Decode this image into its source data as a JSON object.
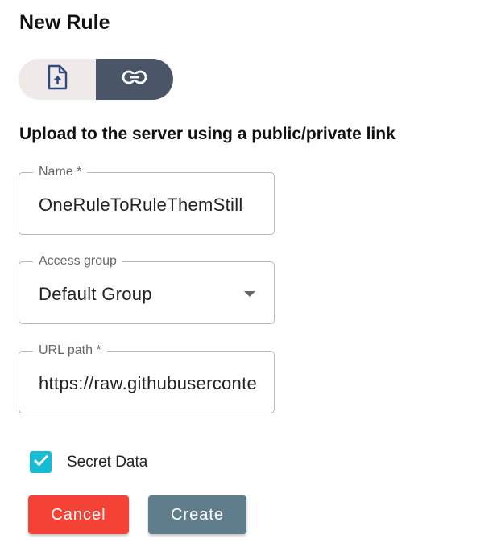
{
  "dialog": {
    "title": "New Rule",
    "subtitle": "Upload to the server using a public/private link"
  },
  "source_toggle": {
    "options": [
      {
        "icon": "file-upload-icon",
        "selected": false
      },
      {
        "icon": "link-icon",
        "selected": true
      }
    ]
  },
  "fields": {
    "name": {
      "label": "Name *",
      "value": "OneRuleToRuleThemStill"
    },
    "access_group": {
      "label": "Access group",
      "value": "Default Group"
    },
    "url_path": {
      "label": "URL path *",
      "value": "https://raw.githubusercontent.com"
    }
  },
  "secret_data": {
    "label": "Secret Data",
    "checked": true
  },
  "actions": {
    "cancel_label": "Cancel",
    "create_label": "Create"
  },
  "colors": {
    "toggle_selected": "#4a5668",
    "toggle_unselected": "#efe9e9",
    "checkbox": "#17bcd4",
    "cancel": "#f44336",
    "create": "#607d8b"
  }
}
